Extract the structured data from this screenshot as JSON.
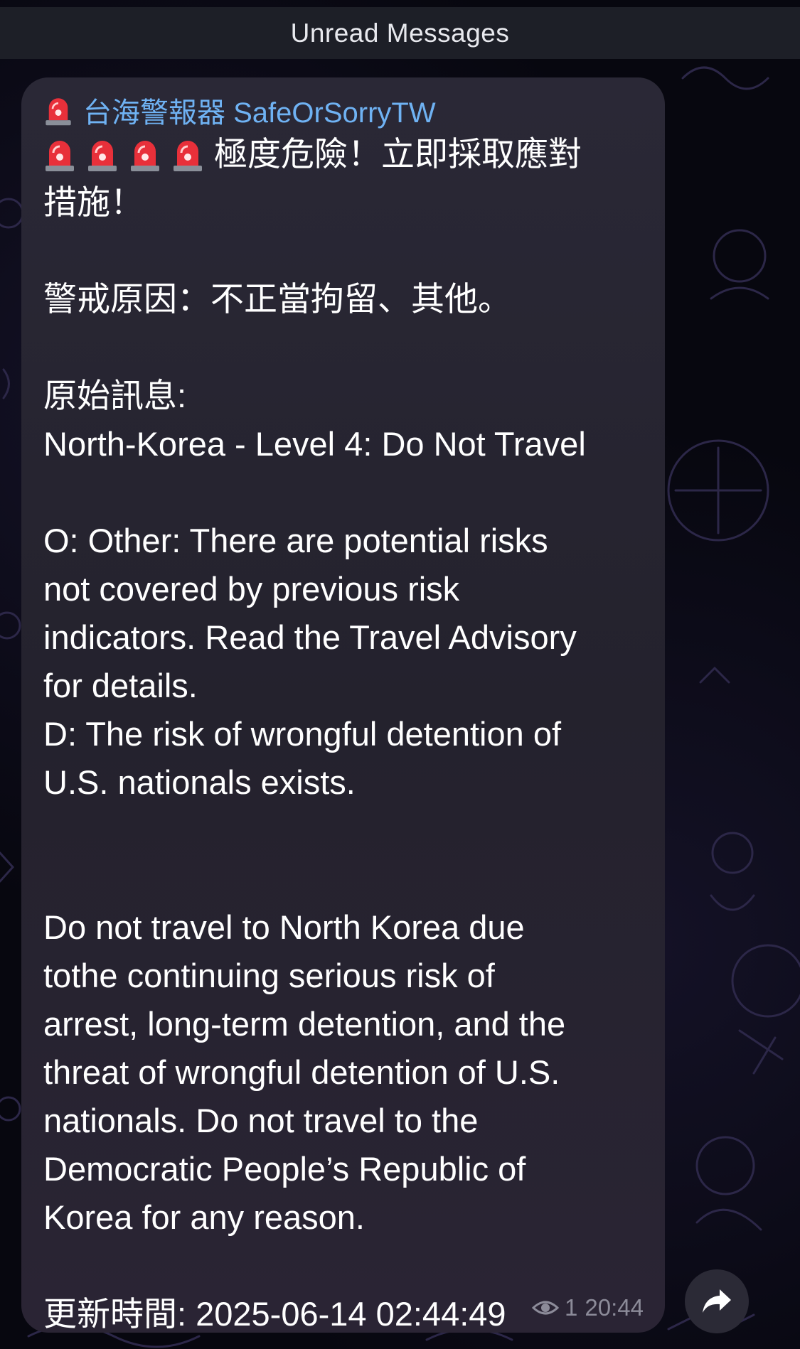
{
  "unread_bar": {
    "label": "Unread Messages"
  },
  "message": {
    "sender": "台海警報器 SafeOrSorryTW",
    "headline_line1": "極度危險！立即採取應對",
    "headline_line2": "措施！",
    "reason": "警戒原因：不正當拘留、其他。",
    "original_label": "原始訊息:",
    "original_title": "North-Korea - Level 4: Do Not Travel",
    "indicator_lines": [
      "O: Other: There are potential risks",
      "not covered by previous risk",
      "indicators. Read the Travel Advisory",
      "for details.",
      "D: The risk of wrongful detention of",
      "U.S. nationals exists."
    ],
    "body_lines": [
      "Do not travel to North Korea due",
      "tothe continuing serious risk of",
      "arrest, long-term detention, and the",
      "threat of wrongful detention of U.S.",
      "nationals. Do not travel to the",
      "Democratic People’s Republic of",
      "Korea for any reason."
    ],
    "updated": "更新時間: 2025-06-14 02:44:49",
    "views": "1",
    "time": "20:44"
  },
  "icons": {
    "siren": "rotating-light-icon",
    "views": "eye-icon",
    "share": "share-arrow-icon"
  },
  "colors": {
    "sender": "#6fb2f3",
    "bubble": "#2a2836",
    "meta": "#8c8b99"
  }
}
